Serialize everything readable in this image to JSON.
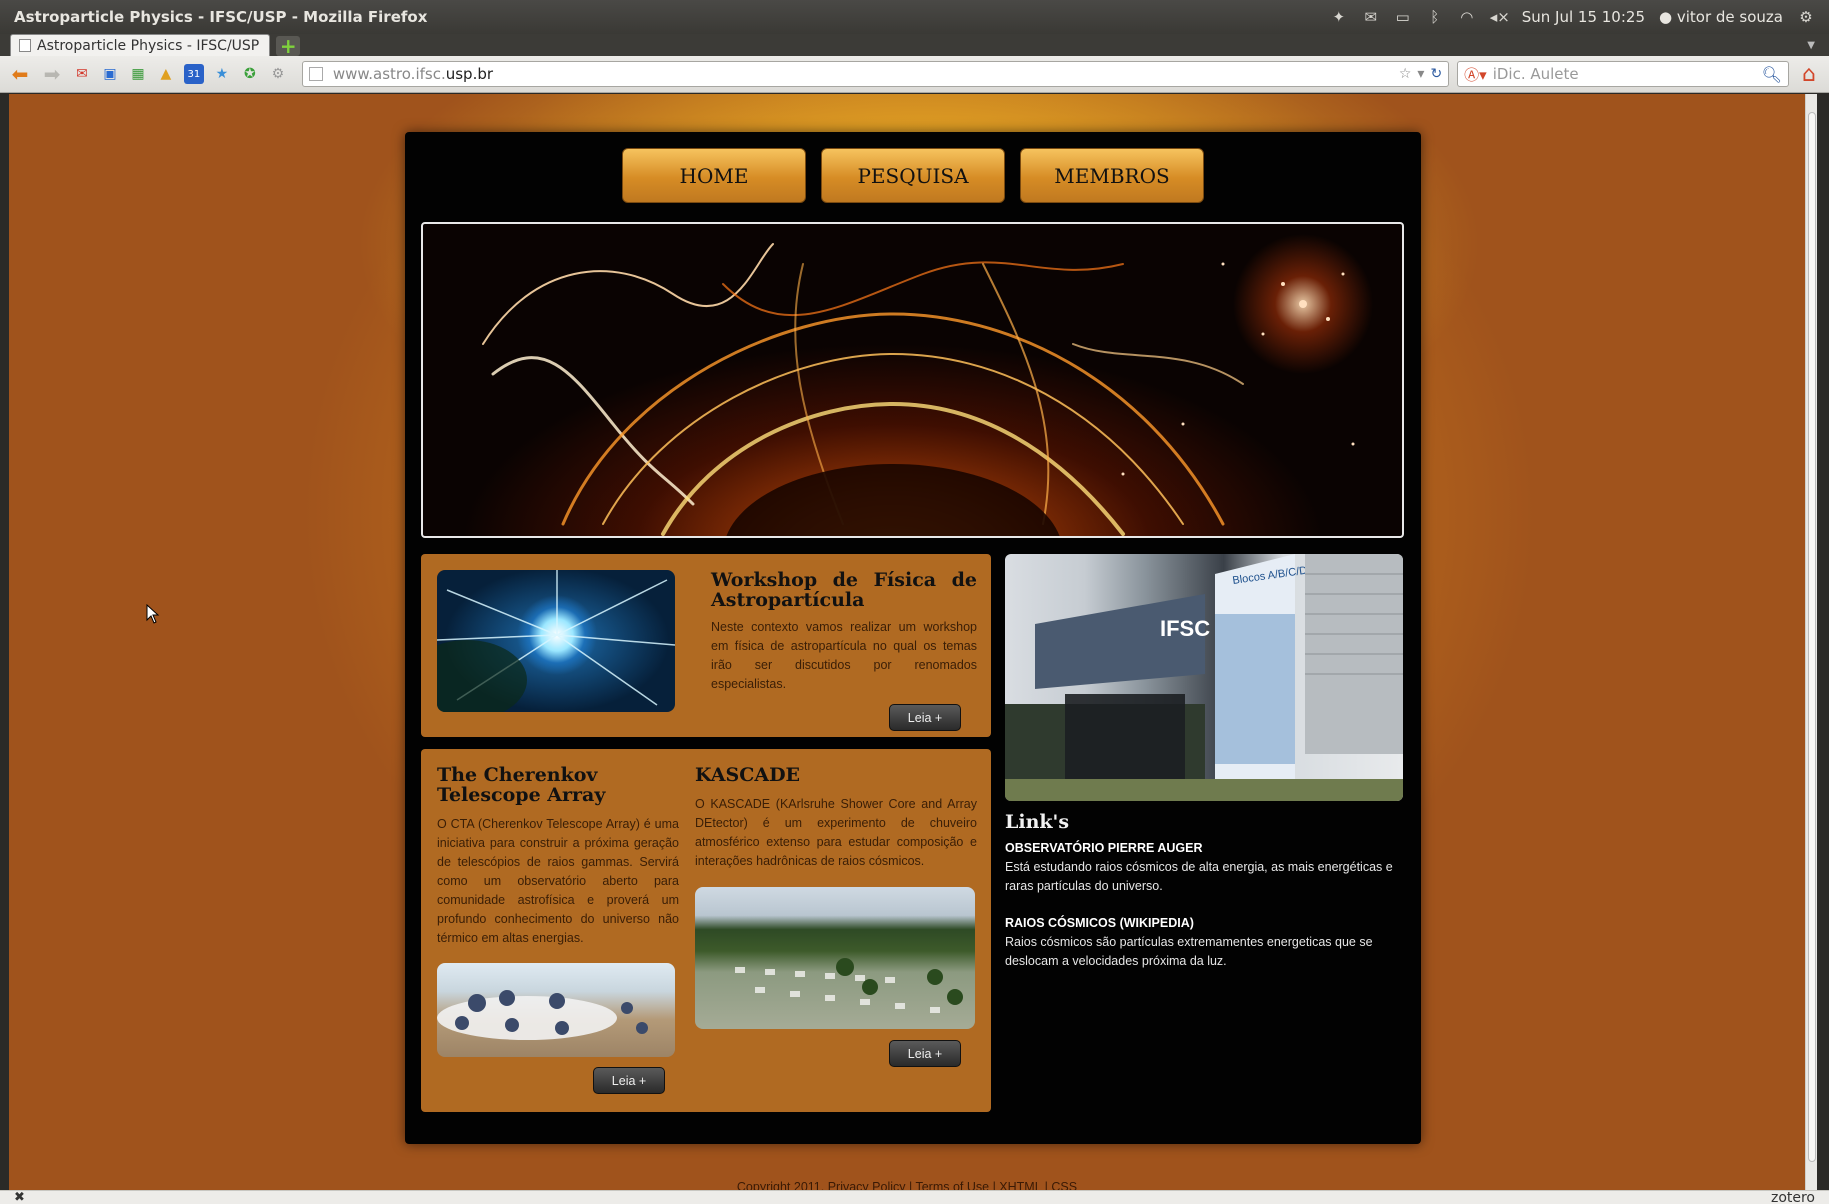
{
  "window": {
    "title": "Astroparticle Physics - IFSC/USP - Mozilla Firefox",
    "clock": "Sun Jul 15 10:25",
    "user": "vitor de souza"
  },
  "tab": {
    "label": "Astroparticle Physics - IFSC/USP"
  },
  "nav": {
    "url_prefix": "www.astro.ifsc.",
    "url_domain": "usp.br",
    "search_placeholder": "iDic. Aulete"
  },
  "site": {
    "menu": [
      "HOME",
      "PESQUISA",
      "MEMBROS"
    ],
    "workshop": {
      "title": "Workshop de Física de Astropartícula",
      "text": "Neste contexto vamos realizar um workshop em física de astropartícula no qual os temas irão ser discutidos por renomados especialistas.",
      "button": "Leia +"
    },
    "cta": {
      "title": "The Cherenkov Telescope Array",
      "text": "O CTA (Cherenkov Telescope Array) é uma iniciativa para construir a próxima geração de telescópios de raios gammas. Servirá como um observatório aberto para comunidade astrofísica e proverá um profundo conhecimento do universo não térmico em altas energias.",
      "button": "Leia +"
    },
    "kascade": {
      "title": "KASCADE",
      "text": "O KASCADE (KArlsruhe Shower Core and Array DEtector) é um experimento de chuveiro atmosférico extenso para estudar composição e interações hadrônicas de raios cósmicos.",
      "button": "Leia +"
    },
    "links": {
      "title": "Link's",
      "items": [
        {
          "head": "OBSERVATÓRIO PIERRE AUGER",
          "desc": "Está estudando raios cósmicos de alta energia, as mais energéticas e raras partículas do universo."
        },
        {
          "head": "RAIOS CÓSMICOS (WIKIPEDIA)",
          "desc": "Raios cósmicos são partículas extremamentes energeticas que se deslocam a velocidades próxima da luz."
        }
      ]
    },
    "photo_text": {
      "sign": "IFSC",
      "blocks": "Blocos A/B/C/D"
    },
    "footer": "Copyright 2011. Privacy Policy | Terms of Use | XHTML | CSS"
  },
  "status": {
    "zotero": "zotero"
  },
  "colors": {
    "menu_gold": "#d68c25",
    "content_box": "#b06a22",
    "page_bg": "#a0531c"
  }
}
